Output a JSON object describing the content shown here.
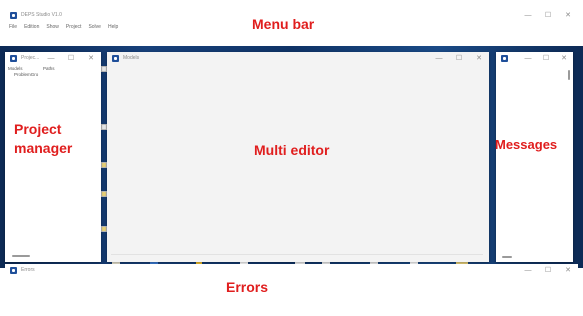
{
  "main_window": {
    "title": "DEPS Studio V1.0",
    "menu": [
      "File",
      "Edition",
      "Show",
      "Project",
      "Solve",
      "Help"
    ],
    "controls": {
      "minimize": "—",
      "maximize": "☐",
      "close": "✕"
    }
  },
  "project_window": {
    "title": "Projec...",
    "tabs": [
      "Models",
      "Paths"
    ],
    "tree_item": "ProblemGro"
  },
  "models_window": {
    "title": "Models"
  },
  "messages_window": {
    "title": ""
  },
  "errors_window": {
    "title": "Errors"
  },
  "annotations": {
    "menu_bar": "Menu bar",
    "project_manager_line1": "Project",
    "project_manager_line2": "manager",
    "multi_editor": "Multi editor",
    "messages": "Messages",
    "errors": "Errors"
  },
  "colors": {
    "annotation": "#e01e1e",
    "app_icon": "#1f4f9a",
    "desktop": "#0f3366"
  }
}
